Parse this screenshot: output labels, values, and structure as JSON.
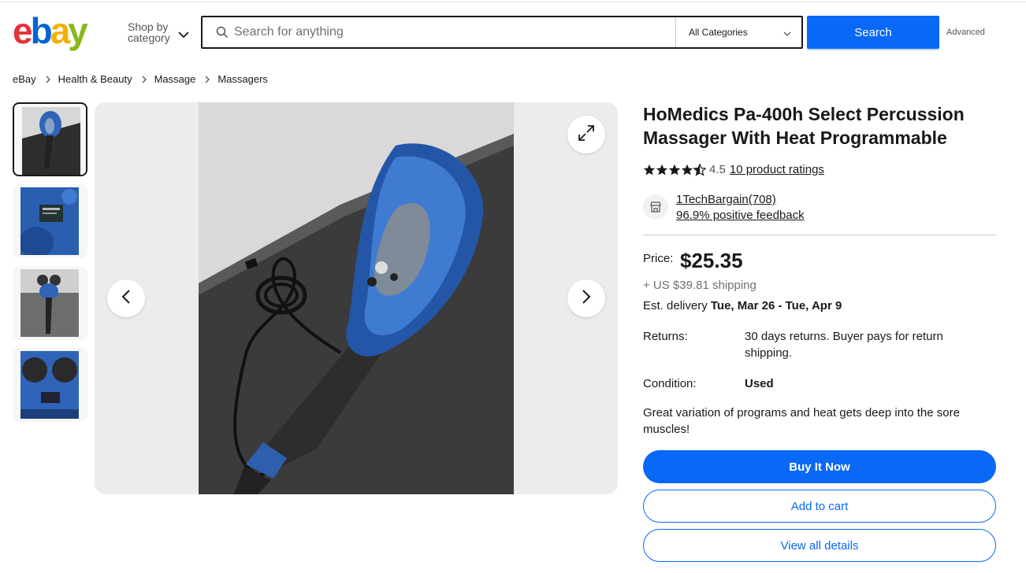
{
  "header": {
    "logo_text": "ebay",
    "shop_by_line1": "Shop by",
    "shop_by_line2": "category",
    "search_placeholder": "Search for anything",
    "category_selected": "All Categories",
    "search_button": "Search",
    "advanced_link": "Advanced"
  },
  "breadcrumb": [
    "eBay",
    "Health & Beauty",
    "Massage",
    "Massagers"
  ],
  "gallery": {
    "thumbnail_count": 4,
    "active_index": 0
  },
  "product": {
    "title": "HoMedics Pa-400h Select Percussion Massager With Heat Programmable",
    "rating_value": "4.5",
    "ratings_link": "10 product ratings",
    "seller_name": "1TechBargain(708)",
    "seller_feedback": "96.9% positive feedback",
    "price_label": "Price:",
    "price": "$25.35",
    "shipping": "+ US $39.81 shipping",
    "delivery_prefix": "Est. delivery",
    "delivery_dates": "Tue, Mar 26 - Tue, Apr 9",
    "returns_label": "Returns:",
    "returns_value": "30 days returns. Buyer pays for return shipping.",
    "condition_label": "Condition:",
    "condition_value": "Used",
    "description": "Great variation of programs and heat gets deep into the sore muscles!"
  },
  "actions": {
    "buy_now": "Buy It Now",
    "add_to_cart": "Add to cart",
    "view_details": "View all details"
  },
  "colors": {
    "accent": "#0968f6",
    "logo_red": "#e53238",
    "logo_blue": "#0064d2",
    "logo_yellow": "#f5af02",
    "logo_green": "#86b817"
  }
}
